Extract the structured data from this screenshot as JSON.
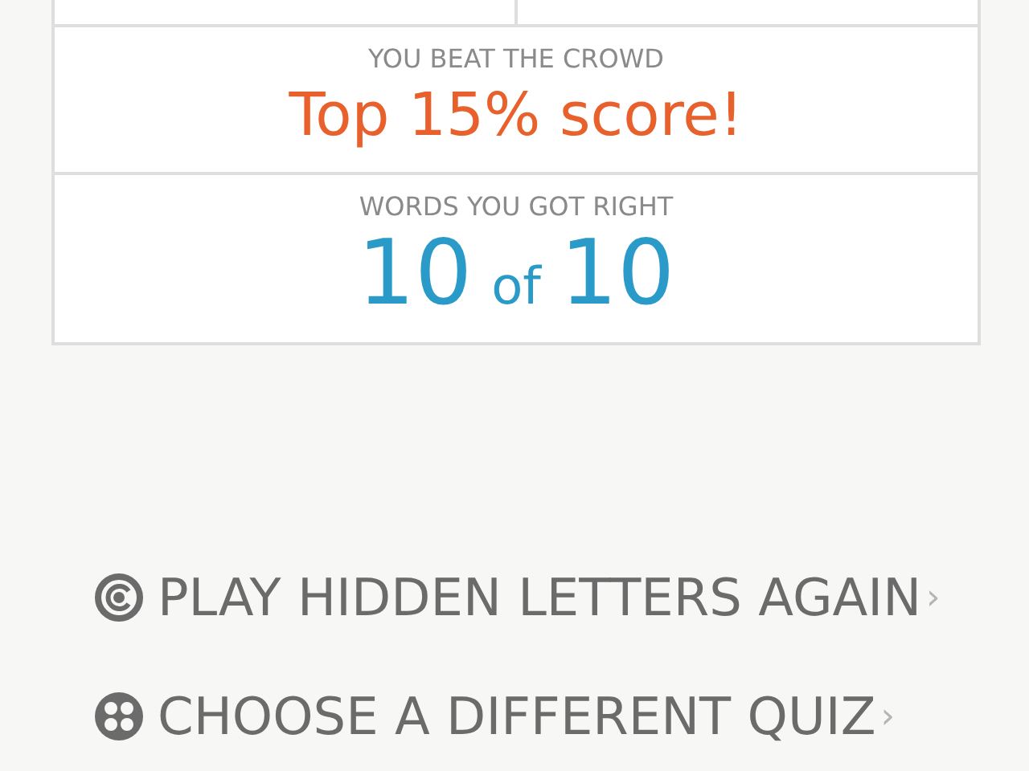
{
  "results_card": {
    "crowd": {
      "label": "YOU BEAT THE CROWD",
      "value": "Top 15% score!"
    },
    "words": {
      "label": "WORDS YOU GOT RIGHT",
      "got": "10",
      "joiner": "of",
      "total": "10"
    }
  },
  "actions": [
    {
      "kind": "replay",
      "label": "PLAY HIDDEN LETTERS AGAIN",
      "chevron": "›"
    },
    {
      "kind": "grid",
      "label": "CHOOSE A DIFFERENT QUIZ",
      "chevron": "›"
    }
  ]
}
